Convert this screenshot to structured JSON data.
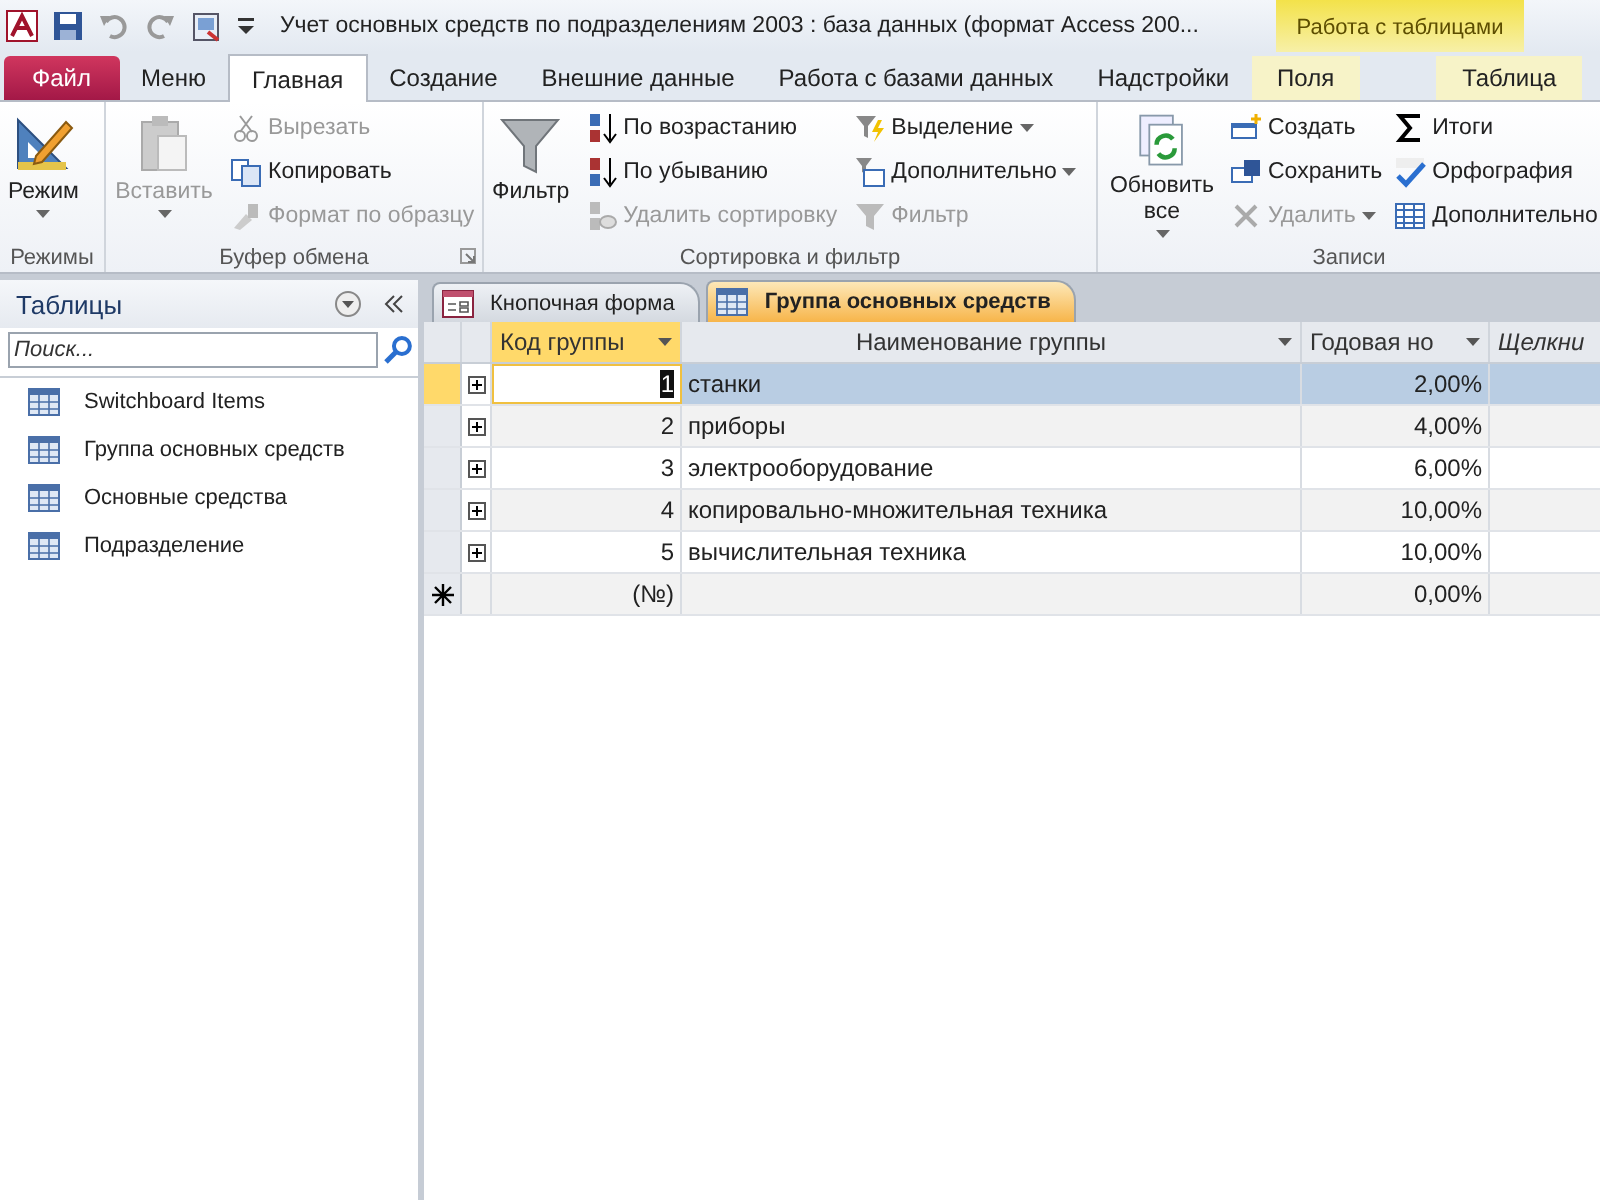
{
  "title_bar": {
    "title": "Учет основных средств по подразделениям 2003 : база данных (формат Access 200...",
    "context_label": "Работа с таблицами"
  },
  "ribbon_tabs": [
    {
      "label": "Файл",
      "kind": "file",
      "selected": false
    },
    {
      "label": "Меню",
      "kind": "normal",
      "selected": false
    },
    {
      "label": "Главная",
      "kind": "normal",
      "selected": true
    },
    {
      "label": "Создание",
      "kind": "normal",
      "selected": false
    },
    {
      "label": "Внешние данные",
      "kind": "normal",
      "selected": false
    },
    {
      "label": "Работа с базами данных",
      "kind": "normal",
      "selected": false
    },
    {
      "label": "Надстройки",
      "kind": "normal",
      "selected": false
    },
    {
      "label": "Поля",
      "kind": "context",
      "selected": false
    },
    {
      "label": "Таблица",
      "kind": "context",
      "selected": false
    }
  ],
  "ribbon_groups": [
    {
      "label": "Режимы",
      "has_launcher": false,
      "large": [
        {
          "label": "Режим",
          "has_menu": true,
          "disabled": false
        }
      ]
    },
    {
      "label": "Буфер обмена",
      "has_launcher": true,
      "large": [
        {
          "label": "Вставить",
          "has_menu": true,
          "disabled": true
        }
      ],
      "columns": [
        [
          {
            "label": "Вырезать",
            "has_menu": false,
            "disabled": true
          },
          {
            "label": "Копировать",
            "has_menu": false,
            "disabled": false
          },
          {
            "label": "Формат по образцу",
            "has_menu": false,
            "disabled": true
          }
        ]
      ]
    },
    {
      "label": "Сортировка и фильтр",
      "has_launcher": false,
      "large": [
        {
          "label": "Фильтр",
          "has_menu": false,
          "disabled": false
        }
      ],
      "columns": [
        [
          {
            "label": "По возрастанию",
            "has_menu": false,
            "disabled": false
          },
          {
            "label": "По убыванию",
            "has_menu": false,
            "disabled": false
          },
          {
            "label": "Удалить сортировку",
            "has_menu": false,
            "disabled": true
          }
        ],
        [
          {
            "label": "Выделение",
            "has_menu": true,
            "disabled": false
          },
          {
            "label": "Дополнительно",
            "has_menu": true,
            "disabled": false
          },
          {
            "label": "Фильтр",
            "has_menu": false,
            "disabled": true
          }
        ]
      ]
    },
    {
      "label": "Записи",
      "has_launcher": false,
      "large": [
        {
          "label": "Обновить все",
          "has_menu": true,
          "disabled": false
        }
      ],
      "columns": [
        [
          {
            "label": "Создать",
            "has_menu": false,
            "disabled": false
          },
          {
            "label": "Сохранить",
            "has_menu": false,
            "disabled": false
          },
          {
            "label": "Удалить",
            "has_menu": true,
            "disabled": true
          }
        ],
        [
          {
            "label": "Итоги",
            "has_menu": false,
            "disabled": false
          },
          {
            "label": "Орфография",
            "has_menu": false,
            "disabled": false
          },
          {
            "label": "Дополнительно",
            "has_menu": false,
            "disabled": false
          }
        ]
      ]
    }
  ],
  "navigation_pane": {
    "title": "Таблицы",
    "search": {
      "placeholder": "Поиск..."
    },
    "items": [
      {
        "label": "Switchboard Items"
      },
      {
        "label": "Группа основных средств"
      },
      {
        "label": "Основные средства"
      },
      {
        "label": "Подразделение"
      }
    ]
  },
  "document_tabs": [
    {
      "label": "Кнопочная форма",
      "kind": "form",
      "selected": false
    },
    {
      "label": "Группа основных средств",
      "kind": "table",
      "selected": true
    }
  ],
  "datasheet": {
    "columns": [
      {
        "label": "Код группы",
        "kind": "number",
        "selected": true
      },
      {
        "label": "Наименование группы",
        "kind": "text",
        "selected": false
      },
      {
        "label": "Годовая но",
        "kind": "number",
        "selected": false
      },
      {
        "label": "Щелкни",
        "kind": "add",
        "selected": false
      }
    ],
    "rows": [
      {
        "code": "1",
        "name": "станки",
        "rate": "2,00%",
        "selected": true
      },
      {
        "code": "2",
        "name": "приборы",
        "rate": "4,00%",
        "selected": false
      },
      {
        "code": "3",
        "name": "электрооборудование",
        "rate": "6,00%",
        "selected": false
      },
      {
        "code": "4",
        "name": "копировально-множительная техника",
        "rate": "10,00%",
        "selected": false
      },
      {
        "code": "5",
        "name": "вычислительная техника",
        "rate": "10,00%",
        "selected": false
      }
    ],
    "new_row": {
      "code": "(№)",
      "rate": "0,00%"
    }
  }
}
